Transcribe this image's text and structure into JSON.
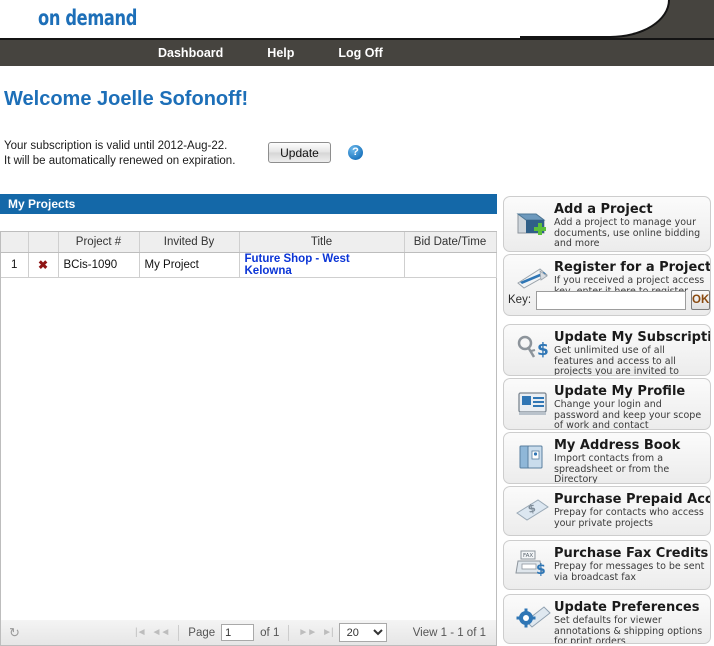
{
  "header": {
    "logo_text": "on demand",
    "nav": [
      {
        "label": "Dashboard",
        "name": "nav-dashboard"
      },
      {
        "label": "Help",
        "name": "nav-help"
      },
      {
        "label": "Log Off",
        "name": "nav-logoff"
      }
    ]
  },
  "welcome": {
    "title": "Welcome Joelle Sofonoff!",
    "subscription_line1": "Your subscription is valid until 2012-Aug-22.",
    "subscription_line2": "It will be automatically renewed on expiration.",
    "update_button": "Update",
    "help_icon": "?"
  },
  "projects": {
    "panel_title": "My Projects",
    "columns": [
      "",
      "",
      "Project #",
      "Invited By",
      "Title",
      "Bid Date/Time"
    ],
    "rows": [
      {
        "num": "1",
        "delete_icon": "✖",
        "project_number": "BCis-1090",
        "invited_by": "My Project",
        "title": "Future Shop - West Kelowna",
        "bid_date_time": ""
      }
    ]
  },
  "pager": {
    "refresh_icon": "↻",
    "first_icon": "|◄",
    "prev_icon": "◄◄",
    "page_label": "Page",
    "page_value": "1",
    "of_label": "of 1",
    "next_icon": "►►",
    "last_icon": "►|",
    "page_size": "20",
    "page_size_options": [
      "20"
    ],
    "view_text": "View 1 - 1 of 1"
  },
  "sidebar": {
    "cards": [
      {
        "name": "add-a-project",
        "icon": "folder-plus-icon",
        "title": "Add a Project",
        "desc": "Add a project to manage your documents, use online bidding and more"
      },
      {
        "name": "register-for-a-project",
        "icon": "pen-signature-icon",
        "title": "Register for a Project",
        "desc": "If you received a project access key, enter it here to register",
        "key_label": "Key:",
        "key_value": "",
        "ok_label": "OK"
      },
      {
        "name": "update-my-subscription",
        "icon": "key-dollar-icon",
        "title": "Update My Subscription",
        "desc": "Get unlimited use of all features and access to all projects you are invited to"
      },
      {
        "name": "update-my-profile",
        "icon": "id-card-icon",
        "title": "Update My Profile",
        "desc": "Change your login and password and keep your scope of work and contact information up-to-date"
      },
      {
        "name": "my-address-book",
        "icon": "address-book-icon",
        "title": "My Address Book",
        "desc": "Import contacts from a spreadsheet or from the Directory"
      },
      {
        "name": "purchase-prepaid-access",
        "icon": "card-dollar-icon",
        "title": "Purchase Prepaid Access",
        "desc": "Prepay for contacts who access your private projects"
      },
      {
        "name": "purchase-fax-credits",
        "icon": "fax-dollar-icon",
        "title": "Purchase Fax Credits",
        "desc": "Prepay for messages to be sent via broadcast fax"
      },
      {
        "name": "update-preferences",
        "icon": "gear-page-icon",
        "title": "Update Preferences",
        "desc": "Set defaults for viewer annotations & shipping options for print orders"
      }
    ]
  },
  "colors": {
    "brand_blue": "#1d6fb8",
    "panel_blue": "#1468a8",
    "nav_dark": "#46443f",
    "link_blue": "#0b35d6",
    "delete_red": "#8f1515"
  }
}
